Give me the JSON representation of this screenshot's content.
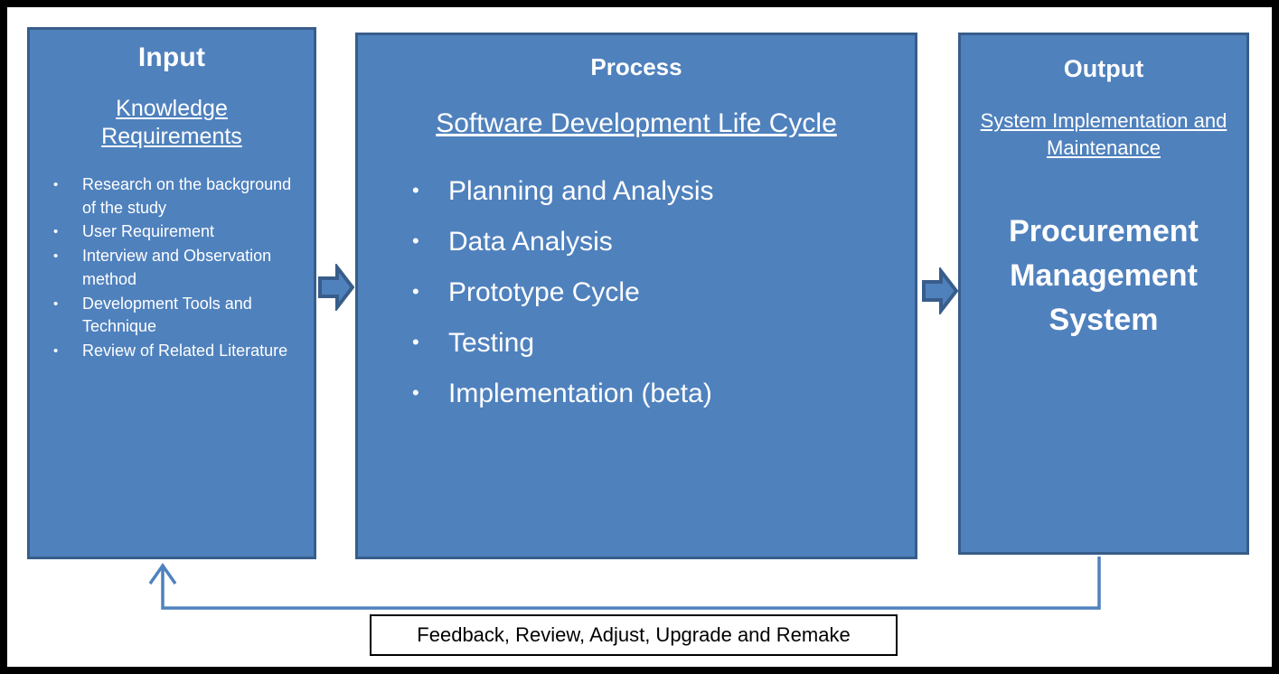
{
  "diagram": {
    "type": "input-process-output",
    "colors": {
      "box_fill": "#4F81BD",
      "box_border": "#385D8A",
      "frame_border": "#000000",
      "arrow_fill": "#4F81BD",
      "arrow_border": "#385D8A",
      "connector_line": "#4F81BD",
      "text_on_box": "#FFFFFF",
      "feedback_text": "#000000"
    }
  },
  "input": {
    "title": "Input",
    "subtitle": "Knowledge Requirements",
    "bullet": "•",
    "items": [
      "Research on the background of the study",
      "User Requirement",
      "Interview and Observation method",
      "Development Tools and Technique",
      "Review of Related Literature"
    ]
  },
  "process": {
    "title": "Process",
    "subtitle": "Software Development Life Cycle",
    "bullet": "•",
    "items": [
      "Planning and Analysis",
      "Data Analysis",
      "Prototype Cycle",
      "Testing",
      "Implementation (beta)"
    ]
  },
  "output": {
    "title": "Output",
    "subtitle": "System Implementation and Maintenance",
    "main_text": "Procurement Management System"
  },
  "connectors": {
    "arrow_input_to_process": "right-block-arrow",
    "arrow_process_to_output": "right-block-arrow",
    "feedback_loop": "feedback-return-arrow"
  },
  "feedback": {
    "text": "Feedback, Review, Adjust, Upgrade and Remake"
  }
}
